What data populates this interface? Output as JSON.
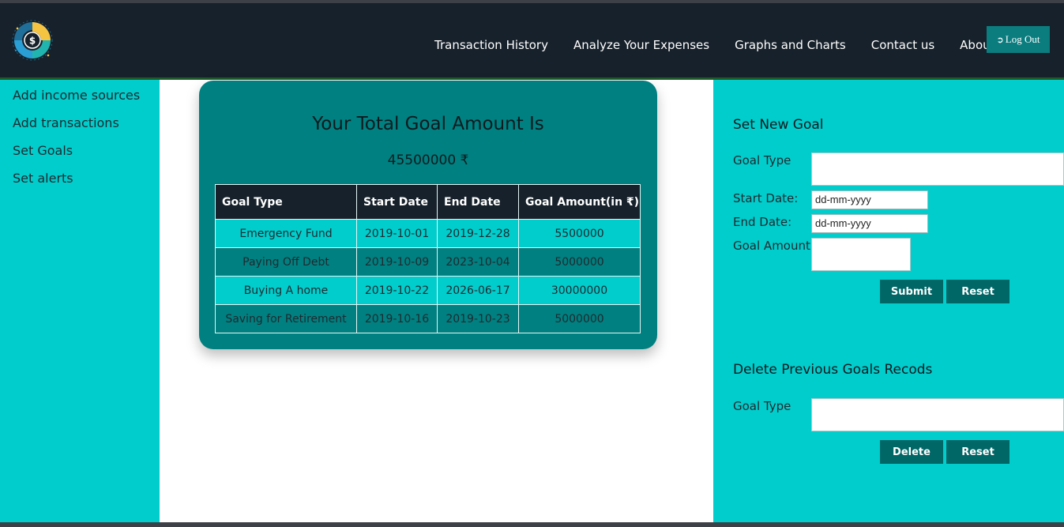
{
  "nav": {
    "links": [
      "Transaction History",
      "Analyze Your Expenses",
      "Graphs and Charts",
      "Contact us",
      "About"
    ],
    "logout_label": "Log Out",
    "logout_icon": "sign-out-icon"
  },
  "logo": {
    "symbol": "$",
    "name": "finance-logo"
  },
  "sidebar": {
    "items": [
      "Add income sources",
      "Add transactions",
      "Set Goals",
      "Set alerts"
    ]
  },
  "summary": {
    "title": "Your Total Goal Amount Is",
    "amount": "45500000 ₹"
  },
  "goals_table": {
    "headers": [
      "Goal Type",
      "Start Date",
      "End Date",
      "Goal Amount(in ₹)"
    ],
    "rows": [
      [
        "Emergency Fund",
        "2019-10-01",
        "2019-12-28",
        "5500000"
      ],
      [
        "Paying Off Debt",
        "2019-10-09",
        "2023-10-04",
        "5000000"
      ],
      [
        "Buying A home",
        "2019-10-22",
        "2026-06-17",
        "30000000"
      ],
      [
        "Saving for Retirement",
        "2019-10-16",
        "2019-10-23",
        "5000000"
      ]
    ]
  },
  "set_goal": {
    "heading": "Set New Goal",
    "goal_type_label": "Goal Type",
    "start_date_label": "Start Date:",
    "start_date_placeholder": "dd-mm-yyyy",
    "end_date_label": "End Date:",
    "end_date_placeholder": "dd-mm-yyyy",
    "goal_amount_label": "Goal Amount:",
    "submit_label": "Submit",
    "reset_label": "Reset"
  },
  "delete_goal": {
    "heading": "Delete Previous Goals Recods",
    "goal_type_label": "Goal Type",
    "delete_label": "Delete",
    "reset_label": "Reset"
  },
  "colors": {
    "navbar": "#17212b",
    "cyan": "#00cdcc",
    "teal": "#008080",
    "button": "#006666"
  }
}
